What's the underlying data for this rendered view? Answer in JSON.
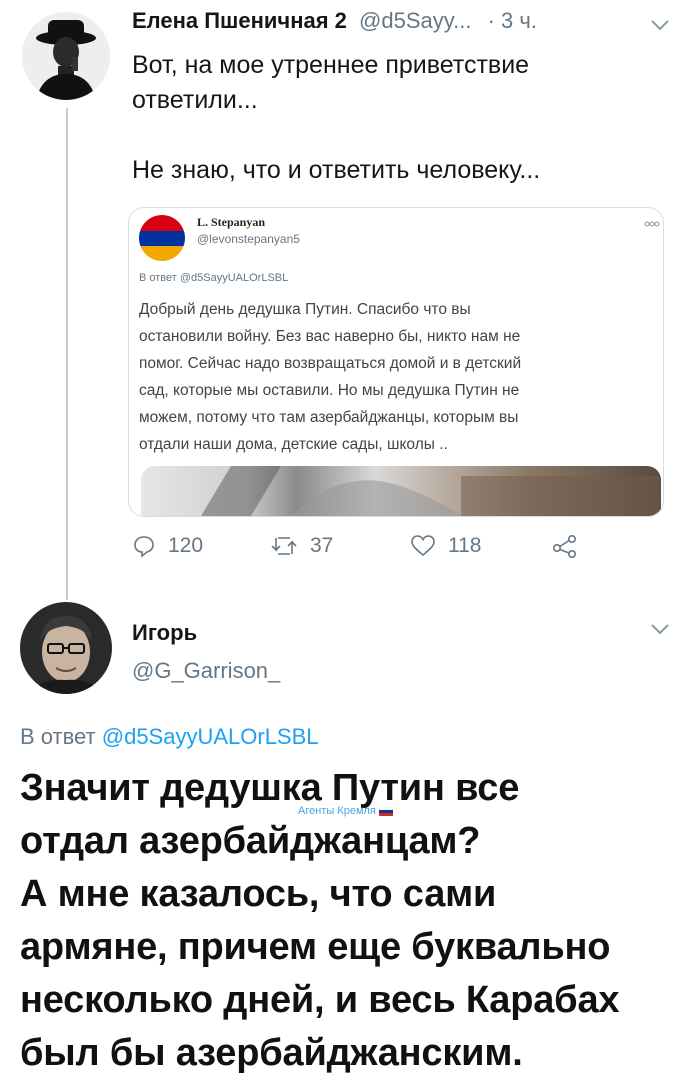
{
  "tweet1": {
    "author_name": "Елена Пшеничная 2",
    "author_handle": "@d5Sayy...",
    "time": "· 3 ч.",
    "text_line1": "Вот, на мое утреннее приветствие",
    "text_line2": "ответили...",
    "text_line3": "Не знаю, что и ответить человеку...",
    "stats": {
      "replies": "120",
      "retweets": "37",
      "likes": "118"
    }
  },
  "quoted": {
    "author_name": "L. Stepanyan",
    "author_handle": "@levonstepanyan5",
    "reply_to": "В ответ @d5SayyUALOrLSBL",
    "lines": [
      "Добрый день дедушка Путин. Спасибо что вы",
      "остановили войну. Без вас наверно бы, никто нам не",
      "помог. Сейчас надо возвращаться домой и в детский",
      "сад, которые мы оставили. Но мы дедушка Путин не",
      "можем, потому что там азербайджанцы, которым вы",
      "отдали наши дома, детские сады, школы .."
    ],
    "menu_icon": "more-icon",
    "flag_colors": [
      "#d90012",
      "#0033a0",
      "#f2a800"
    ]
  },
  "tweet2": {
    "author_name": "Игорь",
    "author_handle": "@G_Garrison_",
    "reply_prefix": "В ответ ",
    "reply_handle": "@d5SayyUALOrLSBL",
    "lines": [
      "Значит дедушка Путин все",
      "отдал азербайджанцам?",
      "А мне казалось, что сами",
      "армяне, причем еще буквально",
      "несколько дней, и весь Карабах",
      "был бы азербайджанским."
    ]
  },
  "watermark": {
    "text": "Агенты Кремля"
  },
  "colors": {
    "link": "#1da1f2",
    "muted": "#657786",
    "text": "#14171a"
  }
}
